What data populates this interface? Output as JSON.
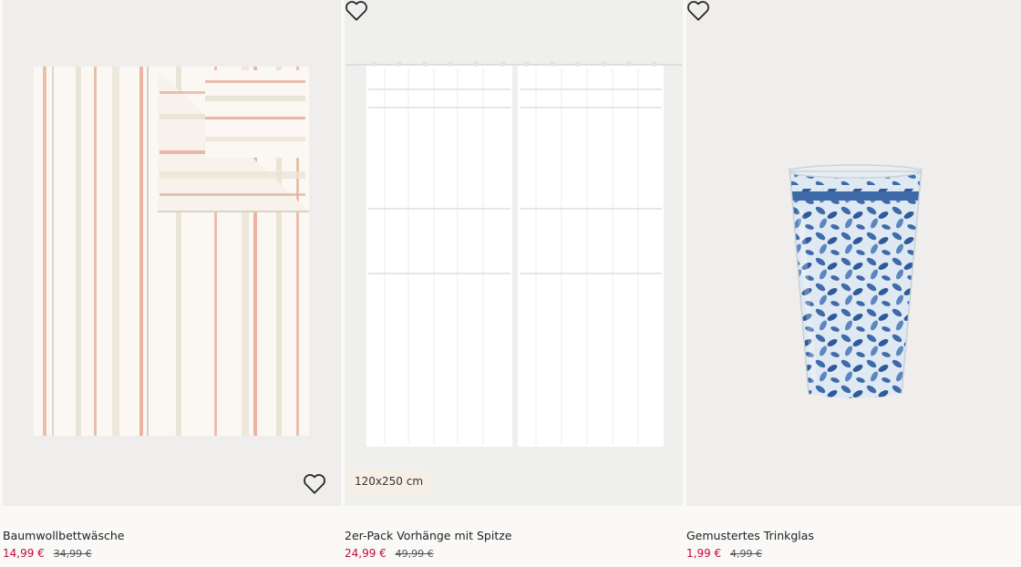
{
  "products": [
    {
      "title": "Baumwollbettwäsche",
      "price_sale": "14,99 €",
      "price_old": "34,99 €",
      "image_icon": "bedding-image",
      "favorite_icon": "heart-outline-icon"
    },
    {
      "title": "2er-Pack Vorhänge mit Spitze",
      "price_sale": "24,99 €",
      "price_old": "49,99 €",
      "badge": "120x250 cm",
      "image_icon": "curtains-image",
      "favorite_icon": "heart-outline-icon"
    },
    {
      "title": "Gemustertes Trinkglas",
      "price_sale": "1,99 €",
      "price_old": "4,99 €",
      "image_icon": "glass-image",
      "favorite_icon": "heart-outline-icon"
    }
  ],
  "colors": {
    "sale": "#c4093a",
    "background": "#faf9f8",
    "image_bg": "#efeeec",
    "badge_bg": "#f6efe6"
  }
}
